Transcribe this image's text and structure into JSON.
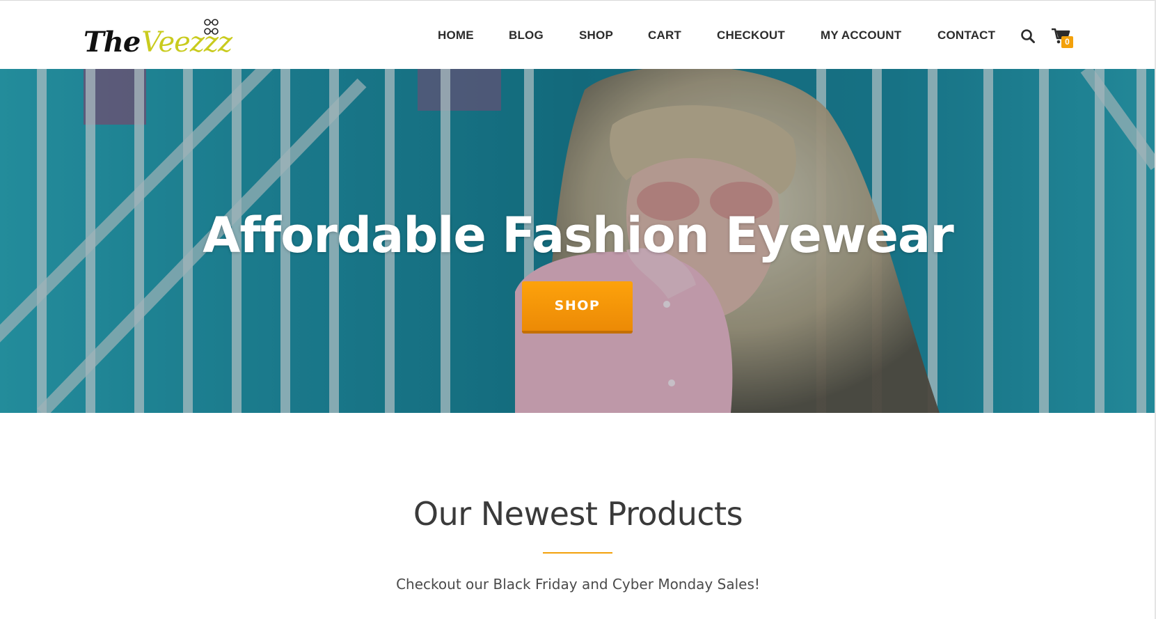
{
  "header": {
    "logo": {
      "part1": "The",
      "part2": "Veezzz"
    },
    "nav": [
      {
        "label": "HOME"
      },
      {
        "label": "BLOG"
      },
      {
        "label": "SHOP"
      },
      {
        "label": "CART"
      },
      {
        "label": "CHECKOUT"
      },
      {
        "label": "MY ACCOUNT"
      },
      {
        "label": "CONTACT"
      }
    ],
    "cart_count": "0",
    "icons": {
      "search": "search-icon",
      "cart": "shopping-cart-icon"
    }
  },
  "hero": {
    "title": "Affordable Fashion Eyewear",
    "button_label": "SHOP"
  },
  "products": {
    "title": "Our Newest Products",
    "subtitle": "Checkout our Black Friday and Cyber Monday Sales!"
  },
  "colors": {
    "accent": "#f3a10b",
    "logo_green": "#c9cb1e",
    "nav_text": "#2b2b2b",
    "hero_teal": "#1f8fa0"
  }
}
